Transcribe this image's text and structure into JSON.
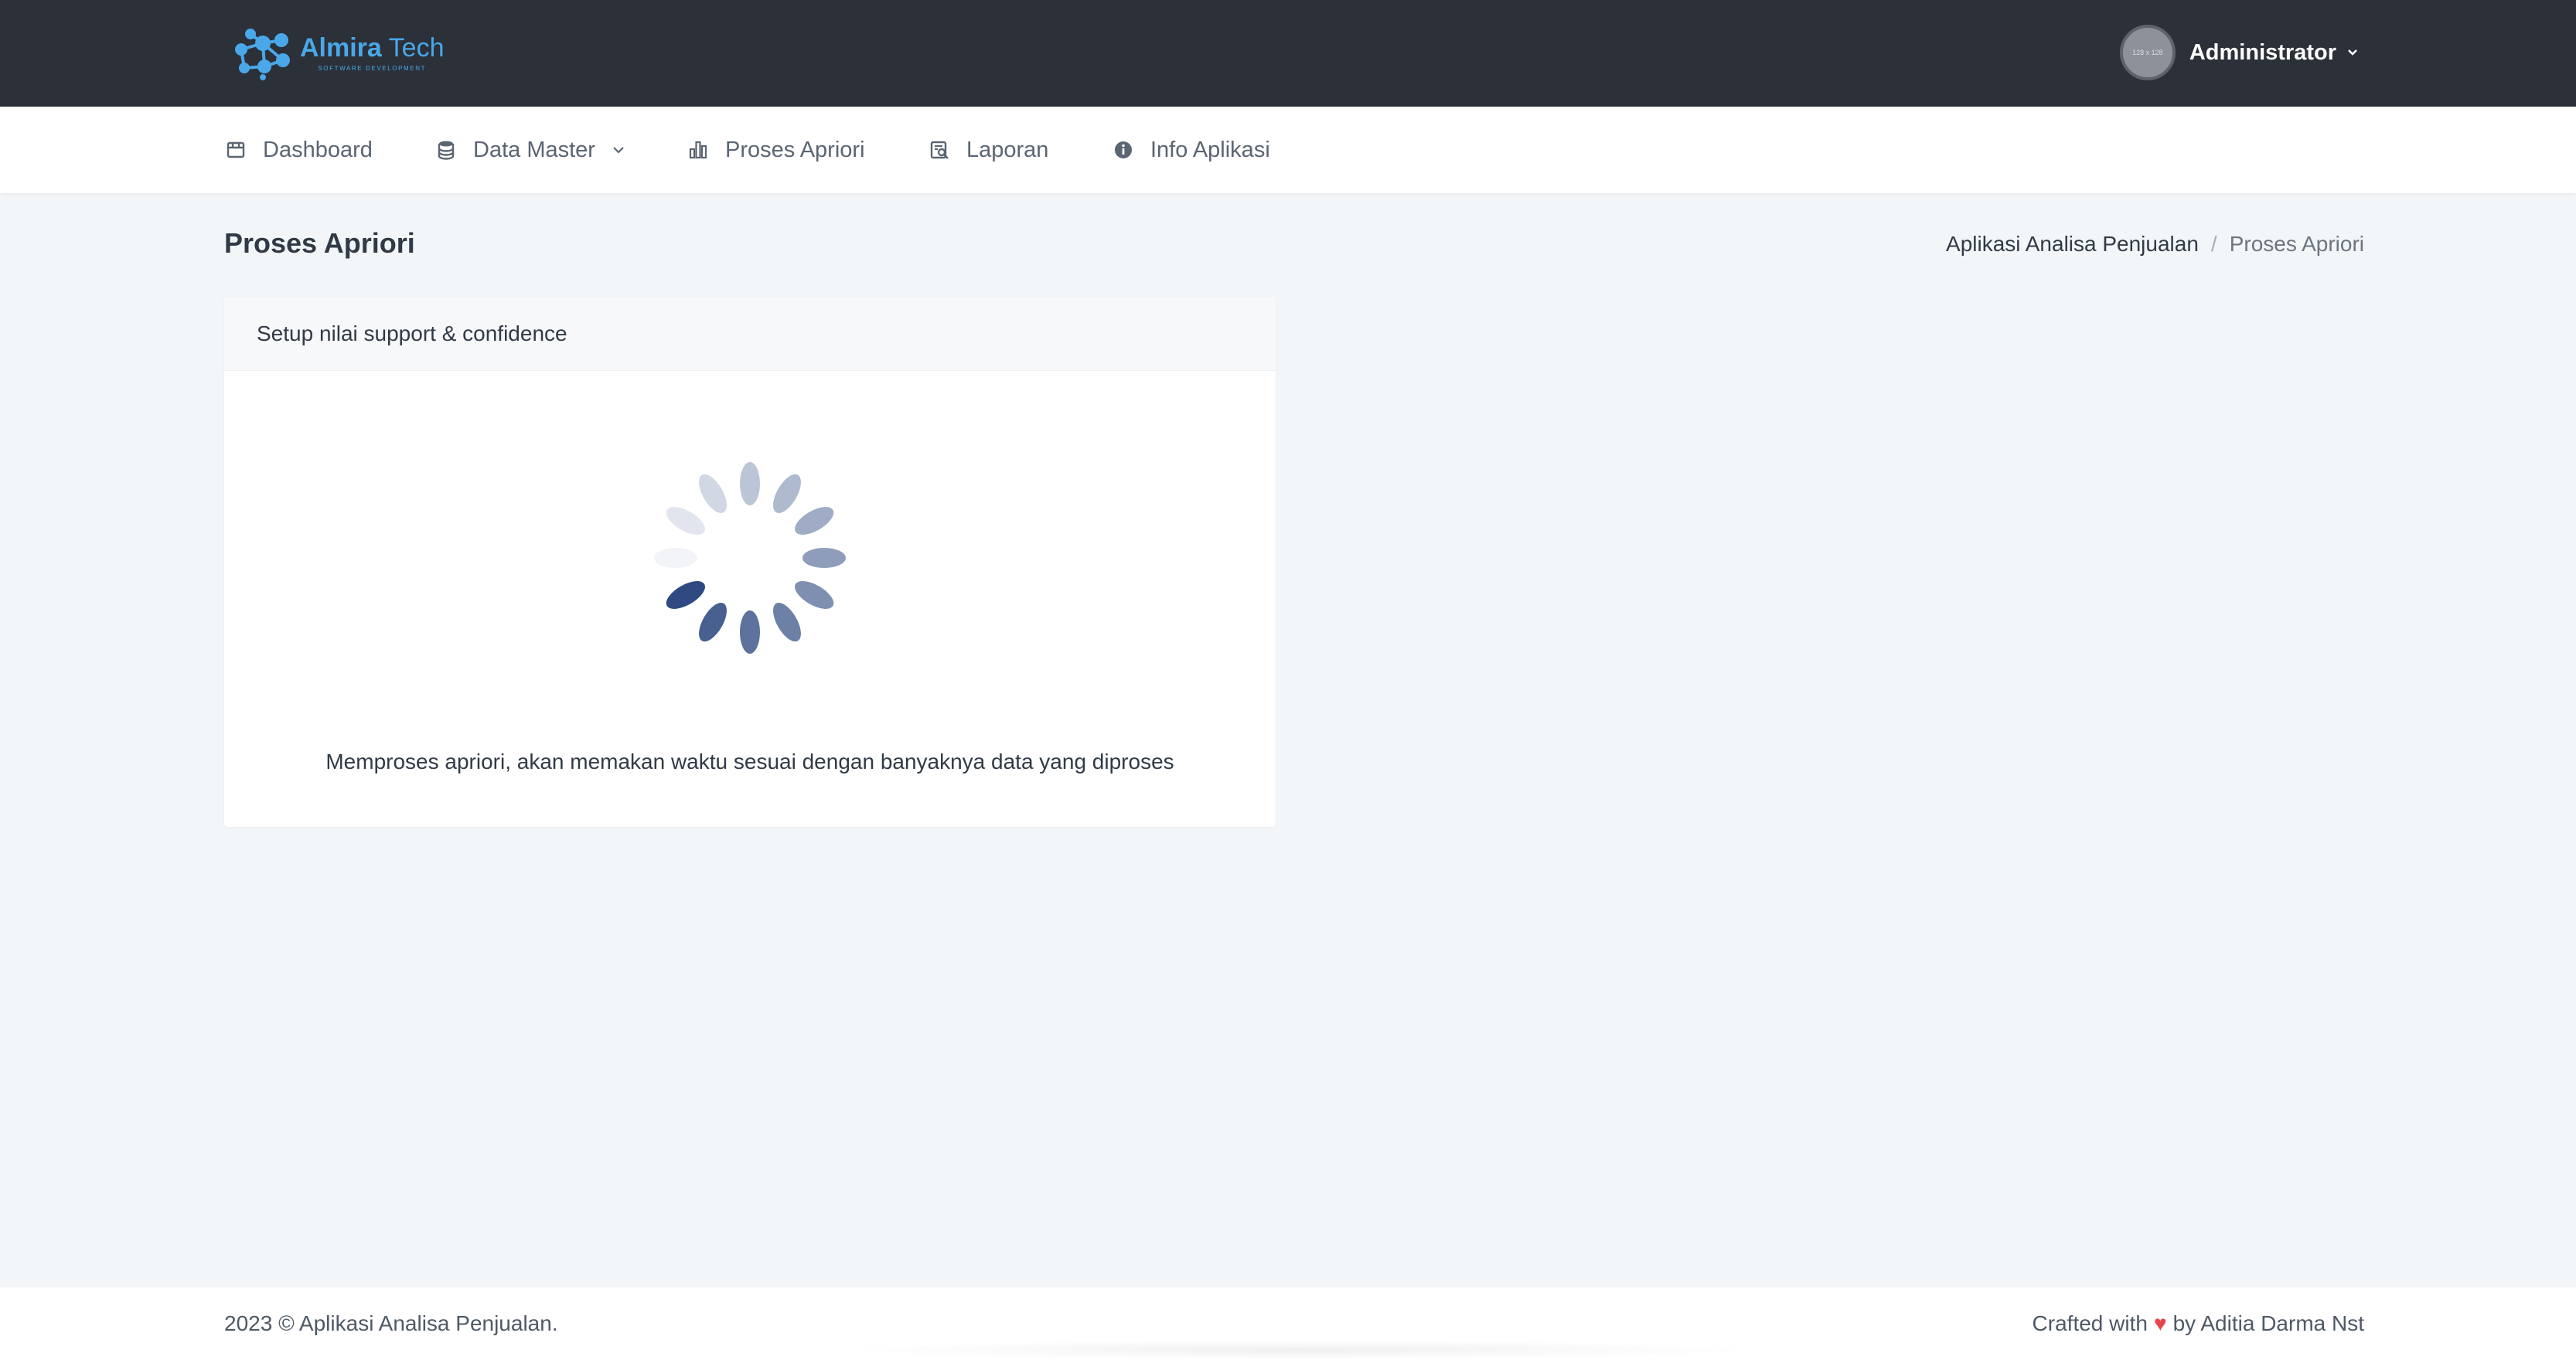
{
  "header": {
    "logo": {
      "name_bold": "Almira",
      "name_rest": " Tech",
      "tagline": "SOFTWARE DEVELOPMENT"
    },
    "user": {
      "avatar_text": "128 x 128",
      "name": "Administrator"
    }
  },
  "nav": {
    "items": [
      {
        "label": "Dashboard",
        "icon": "store-icon"
      },
      {
        "label": "Data Master",
        "icon": "database-icon",
        "has_dropdown": true
      },
      {
        "label": "Proses Apriori",
        "icon": "bar-chart-icon"
      },
      {
        "label": "Laporan",
        "icon": "report-search-icon"
      },
      {
        "label": "Info Aplikasi",
        "icon": "info-icon"
      }
    ]
  },
  "page": {
    "title": "Proses Apriori",
    "breadcrumb": {
      "parent": "Aplikasi Analisa Penjualan",
      "separator": "/",
      "current": "Proses Apriori"
    }
  },
  "card": {
    "header": "Setup nilai support & confidence",
    "message": "Memproses apriori, akan memakan waktu sesuai dengan banyaknya data yang diproses"
  },
  "footer": {
    "left": "2023 © Aplikasi Analisa Penjualan.",
    "right_prefix": "Crafted with",
    "heart": "♥",
    "right_suffix": "by Aditia Darma Nst"
  },
  "colors": {
    "topbar": "#2b3039",
    "accent": "#4aa7e8",
    "spinner": "#2f4a80",
    "heart": "#e8434b",
    "page_bg": "#f3f6f8"
  }
}
